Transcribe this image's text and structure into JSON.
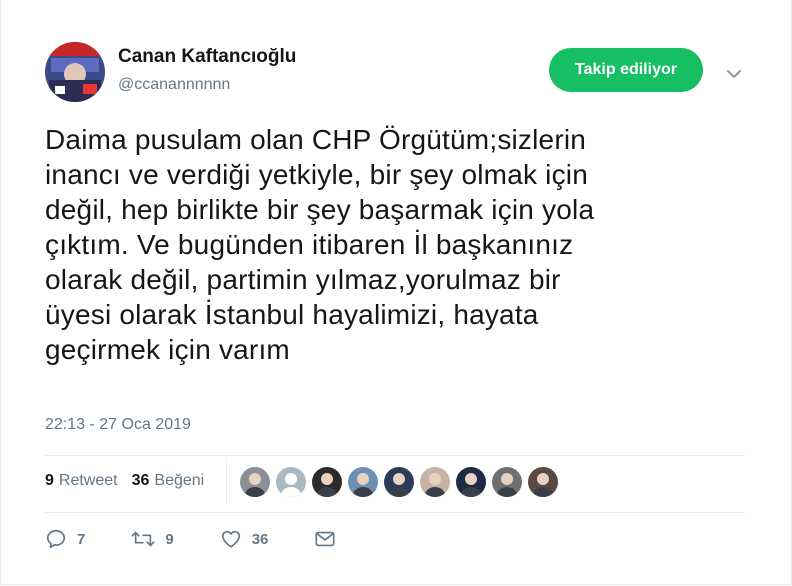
{
  "user": {
    "name": "Canan Kaftancıoğlu",
    "handle": "@ccanannnnnn"
  },
  "follow_button": {
    "label": "Takip ediliyor",
    "color": "#17bf63"
  },
  "tweet": {
    "text": "Daima pusulam olan CHP Örgütüm;sizlerin\ninancı ve verdiği yetkiyle, bir şey olmak için\ndeğil, hep birlikte bir şey başarmak için yola\nçıktım. Ve bugünden itibaren İl başkanınız\nolarak değil, partimin yılmaz,yorulmaz bir\nüyesi olarak İstanbul hayalimizi, hayata\ngeçirmek için varım",
    "timestamp": "22:13 - 27 Oca 2019"
  },
  "stats": {
    "retweets_count": "9",
    "retweets_label": "Retweet",
    "likes_count": "36",
    "likes_label": "Beğeni"
  },
  "likers": [
    {
      "icon": "user-avatar-icon",
      "color": "#8a8f98"
    },
    {
      "icon": "default-avatar-icon",
      "color": "#aab8c2"
    },
    {
      "icon": "user-avatar-icon",
      "color": "#2b2b2b"
    },
    {
      "icon": "user-avatar-icon",
      "color": "#6f8fb0"
    },
    {
      "icon": "user-avatar-icon",
      "color": "#2e3a59"
    },
    {
      "icon": "user-avatar-icon",
      "color": "#c7b3a6"
    },
    {
      "icon": "user-avatar-icon",
      "color": "#1f2a44"
    },
    {
      "icon": "user-avatar-icon",
      "color": "#707070"
    },
    {
      "icon": "user-avatar-icon",
      "color": "#5b4a3f"
    }
  ],
  "actions": {
    "reply_count": "7",
    "retweet_count": "9",
    "like_count": "36",
    "reply_icon": "reply-icon",
    "retweet_icon": "retweet-icon",
    "like_icon": "heart-icon",
    "dm_icon": "envelope-icon"
  }
}
